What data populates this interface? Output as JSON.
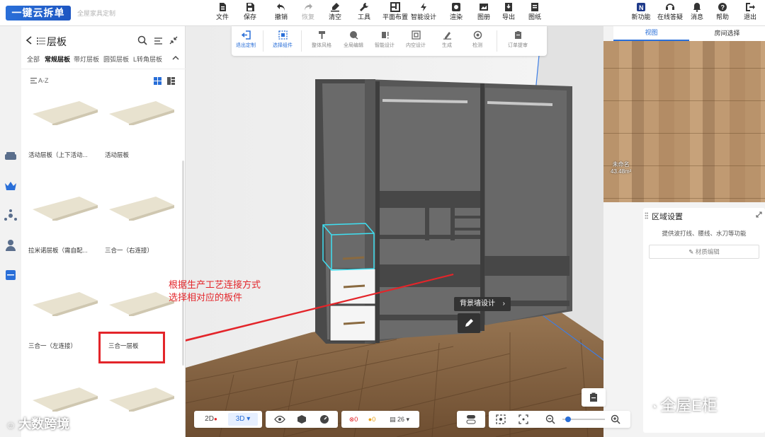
{
  "app": {
    "logo": "一键云拆单",
    "subtitle": "全屋家具定制"
  },
  "toolbar_left": [
    {
      "label": "文件",
      "icon": "file-icon"
    },
    {
      "label": "保存",
      "icon": "save-icon"
    },
    {
      "label": "撤销",
      "icon": "undo-icon"
    },
    {
      "label": "恢复",
      "icon": "redo-icon",
      "disabled": true
    },
    {
      "label": "清空",
      "icon": "clear-icon"
    },
    {
      "label": "工具",
      "icon": "wrench-icon"
    },
    {
      "label": "平面布置",
      "icon": "layout-icon"
    },
    {
      "label": "智能设计",
      "icon": "lightning-icon"
    },
    {
      "label": "渲染",
      "icon": "render-icon"
    },
    {
      "label": "图册",
      "icon": "album-icon"
    },
    {
      "label": "导出",
      "icon": "export-icon"
    },
    {
      "label": "图纸",
      "icon": "drawing-icon"
    }
  ],
  "toolbar_right": [
    {
      "label": "新功能",
      "icon": "new-feature-icon"
    },
    {
      "label": "在线答疑",
      "icon": "headset-icon"
    },
    {
      "label": "消息",
      "icon": "bell-icon"
    },
    {
      "label": "帮助",
      "icon": "help-icon"
    },
    {
      "label": "退出",
      "icon": "logout-icon"
    }
  ],
  "subtoolbar": [
    {
      "label": "退出定制",
      "icon": "exit-custom-icon",
      "active": true
    },
    {
      "label": "选择组件",
      "icon": "select-component-icon",
      "active": true
    },
    {
      "label": "整体风格",
      "icon": "style-icon"
    },
    {
      "label": "全局编辑",
      "icon": "global-edit-icon"
    },
    {
      "label": "智能设计",
      "icon": "smart-design-icon"
    },
    {
      "label": "内空设计",
      "icon": "inner-space-icon"
    },
    {
      "label": "生成",
      "icon": "generate-icon"
    },
    {
      "label": "检测",
      "icon": "check-icon"
    },
    {
      "label": "订单提审",
      "icon": "order-icon"
    }
  ],
  "left_panel": {
    "title": "层板",
    "categories": [
      "全部",
      "常规层板",
      "带灯层板",
      "圆弧层板",
      "L转角层板"
    ],
    "active_category": "常规层板",
    "sort_label": "A-Z",
    "items": [
      "活动层板（上下活动...",
      "活动层板",
      "拉米诺层板（需自配...",
      "三合一（右连接）",
      "三合一（左连接）",
      "三合一层板",
      "",
      ""
    ]
  },
  "right_panel": {
    "tabs": [
      "视图",
      "房间选择"
    ],
    "room_name": "未命名",
    "room_area": "43.48m²",
    "region_title": "区域设置",
    "region_desc": "提供波打线、腰线、水刀等功能",
    "material_button": "材质编辑"
  },
  "scene": {
    "floating_button": "背景墙设计",
    "annotation_line1": "根据生产工艺连接方式",
    "annotation_line2": "选择相对应的板件"
  },
  "bottom_toolbar": {
    "view_2d": "2D",
    "view_3d": "3D",
    "error_count": "0",
    "warning_count": "0",
    "item_count": "26"
  },
  "watermarks": {
    "left": "大数跨境",
    "right": "全屋E柜"
  },
  "colors": {
    "accent": "#2a6fd8",
    "annotation": "#e3252a",
    "wardrobe": "#505050"
  }
}
